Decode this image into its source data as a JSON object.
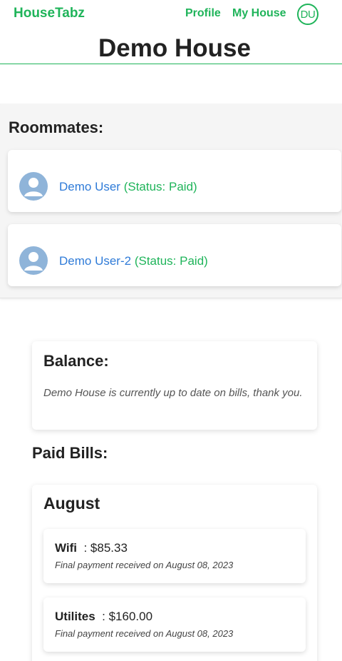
{
  "nav": {
    "brand": "HouseTabz",
    "profile_label": "Profile",
    "my_house_label": "My House",
    "user_initials": "DU"
  },
  "page_title": "Demo House",
  "roommates": {
    "heading": "Roommates:",
    "items": [
      {
        "name": "Demo User",
        "status": "(Status: Paid)"
      },
      {
        "name": "Demo User-2",
        "status": "(Status: Paid)"
      }
    ]
  },
  "balance": {
    "heading": "Balance:",
    "message": "Demo House is currently up to date on bills, thank you."
  },
  "paid_bills": {
    "heading": "Paid Bills:",
    "months": [
      {
        "month": "August",
        "bills": [
          {
            "name": "Wifi",
            "amount": "$85.33",
            "note": "Final payment received on August 08, 2023"
          },
          {
            "name": "Utilites",
            "amount": "$160.00",
            "note": "Final payment received on August 08, 2023"
          }
        ]
      }
    ]
  },
  "colors": {
    "accent": "#1fb45a",
    "link": "#2f7bd8",
    "avatar": "#8fb4d9"
  }
}
